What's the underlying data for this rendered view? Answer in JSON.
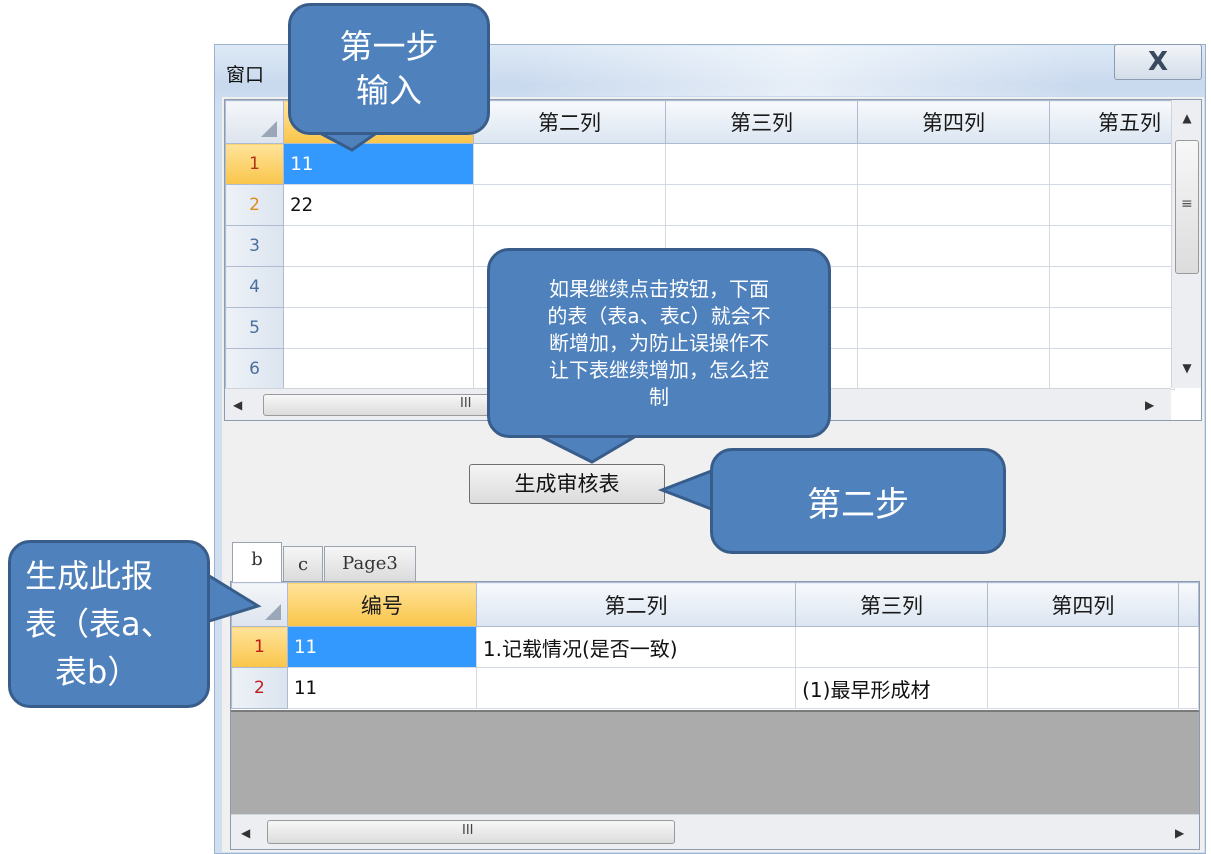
{
  "window": {
    "title": "窗口",
    "close_label": "X"
  },
  "grid1": {
    "columns": [
      "",
      "第二列",
      "第三列",
      "第四列",
      "第五列"
    ],
    "rows": [
      {
        "num": "1",
        "col1": "11"
      },
      {
        "num": "2",
        "col1": "22"
      },
      {
        "num": "3",
        "col1": ""
      },
      {
        "num": "4",
        "col1": ""
      },
      {
        "num": "5",
        "col1": ""
      },
      {
        "num": "6",
        "col1": ""
      }
    ],
    "hscroll_grip": "III",
    "vscroll_grip": "≡"
  },
  "generate_button": {
    "label": "生成审核表"
  },
  "tabs": [
    "b",
    "c",
    "Page3"
  ],
  "grid2": {
    "columns": [
      "编号",
      "第二列",
      "第三列",
      "第四列"
    ],
    "rows": [
      {
        "num": "1",
        "c1": "11",
        "c2": "1.记载情况(是否一致)",
        "c3": "",
        "c4": ""
      },
      {
        "num": "2",
        "c1": "11",
        "c2": "",
        "c3": "(1)最早形成材",
        "c4": ""
      }
    ],
    "hscroll_grip": "III"
  },
  "callouts": {
    "step1": [
      "第一步",
      "输入"
    ],
    "question": [
      "如果继续点击按钮，下面",
      "的表（表a、表c）就会不",
      "断增加，为防止误操作不",
      "让下表继续增加，怎么控",
      "制"
    ],
    "step2": "第二步",
    "generate_report": [
      "生成此报",
      "表（表a、",
      "表b）"
    ]
  },
  "colors": {
    "callout_fill": "#4f81bd",
    "callout_border": "#385d8a",
    "selected_header": "#f9c54a",
    "selected_cell": "#3399ff"
  }
}
